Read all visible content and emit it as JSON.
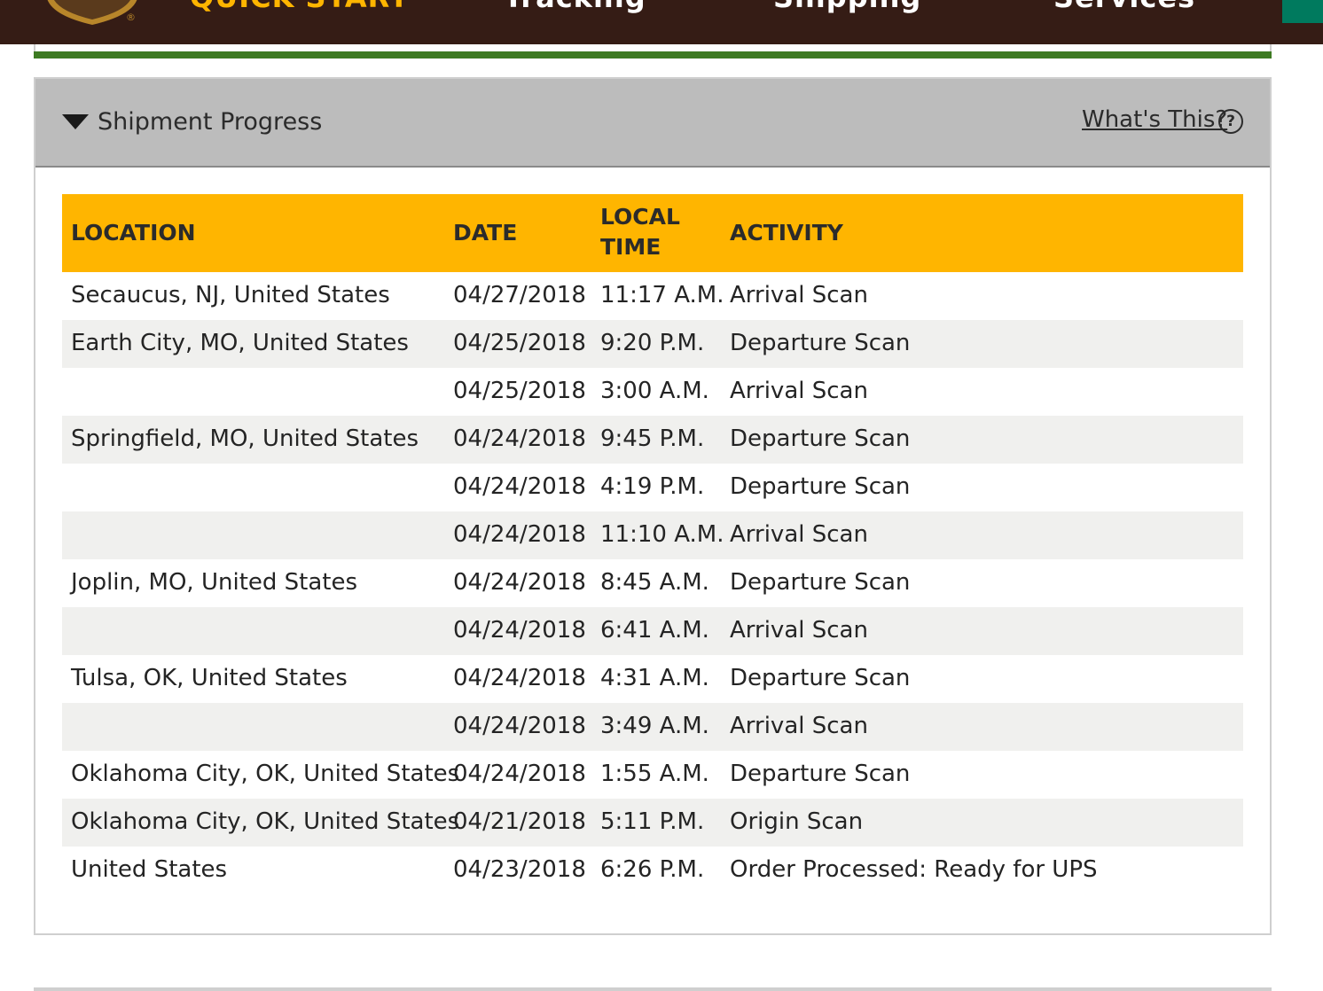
{
  "nav": {
    "quick_start": "QUICK START",
    "tracking": "Tracking",
    "shipping": "Shipping",
    "services": "Services",
    "logo_mark": "®"
  },
  "colors": {
    "nav_bg": "#351c15",
    "ups_gold": "#ffb500",
    "green_rule": "#3d7a22",
    "row_alt": "#f0f0ee"
  },
  "panel": {
    "title": "Shipment Progress",
    "help_link": "What's This?",
    "help_icon": "?"
  },
  "table": {
    "headers": {
      "location": "LOCATION",
      "date": "DATE",
      "local_time": "LOCAL TIME",
      "activity": "ACTIVITY"
    },
    "rows": [
      {
        "location": "Secaucus,  NJ,  United States",
        "date": "04/27/2018",
        "time": "11:17 A.M.",
        "activity": "Arrival Scan"
      },
      {
        "location": "Earth City,  MO,  United States",
        "date": "04/25/2018",
        "time": "9:20 P.M.",
        "activity": "Departure Scan"
      },
      {
        "location": "",
        "date": "04/25/2018",
        "time": "3:00 A.M.",
        "activity": "Arrival Scan"
      },
      {
        "location": "Springfield,  MO,  United States",
        "date": "04/24/2018",
        "time": "9:45 P.M.",
        "activity": "Departure Scan"
      },
      {
        "location": "",
        "date": "04/24/2018",
        "time": "4:19 P.M.",
        "activity": "Departure Scan"
      },
      {
        "location": "",
        "date": "04/24/2018",
        "time": "11:10 A.M.",
        "activity": "Arrival Scan"
      },
      {
        "location": "Joplin,  MO,  United States",
        "date": "04/24/2018",
        "time": "8:45 A.M.",
        "activity": "Departure Scan"
      },
      {
        "location": "",
        "date": "04/24/2018",
        "time": "6:41 A.M.",
        "activity": "Arrival Scan"
      },
      {
        "location": "Tulsa,  OK,  United States",
        "date": "04/24/2018",
        "time": "4:31 A.M.",
        "activity": "Departure Scan"
      },
      {
        "location": "",
        "date": "04/24/2018",
        "time": "3:49 A.M.",
        "activity": "Arrival Scan"
      },
      {
        "location": "Oklahoma City,  OK,  United States",
        "date": "04/24/2018",
        "time": "1:55 A.M.",
        "activity": "Departure Scan"
      },
      {
        "location": "Oklahoma City,  OK,  United States",
        "date": "04/21/2018",
        "time": "5:11 P.M.",
        "activity": "Origin Scan"
      },
      {
        "location": "United States",
        "date": "04/23/2018",
        "time": "6:26 P.M.",
        "activity": "Order Processed: Ready for UPS"
      }
    ]
  }
}
